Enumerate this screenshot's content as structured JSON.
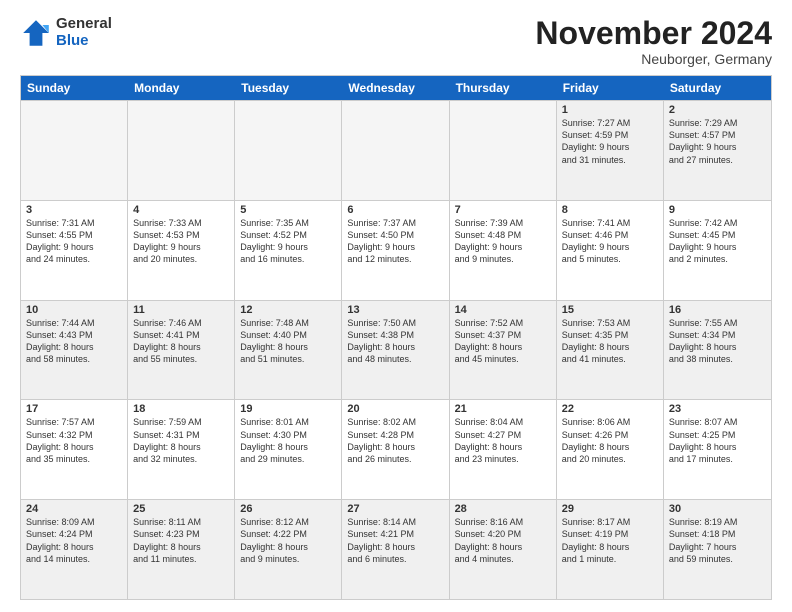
{
  "logo": {
    "general": "General",
    "blue": "Blue"
  },
  "title": "November 2024",
  "location": "Neuborger, Germany",
  "header_days": [
    "Sunday",
    "Monday",
    "Tuesday",
    "Wednesday",
    "Thursday",
    "Friday",
    "Saturday"
  ],
  "weeks": [
    [
      {
        "day": "",
        "info": "",
        "empty": true
      },
      {
        "day": "",
        "info": "",
        "empty": true
      },
      {
        "day": "",
        "info": "",
        "empty": true
      },
      {
        "day": "",
        "info": "",
        "empty": true
      },
      {
        "day": "",
        "info": "",
        "empty": true
      },
      {
        "day": "1",
        "info": "Sunrise: 7:27 AM\nSunset: 4:59 PM\nDaylight: 9 hours\nand 31 minutes."
      },
      {
        "day": "2",
        "info": "Sunrise: 7:29 AM\nSunset: 4:57 PM\nDaylight: 9 hours\nand 27 minutes."
      }
    ],
    [
      {
        "day": "3",
        "info": "Sunrise: 7:31 AM\nSunset: 4:55 PM\nDaylight: 9 hours\nand 24 minutes."
      },
      {
        "day": "4",
        "info": "Sunrise: 7:33 AM\nSunset: 4:53 PM\nDaylight: 9 hours\nand 20 minutes."
      },
      {
        "day": "5",
        "info": "Sunrise: 7:35 AM\nSunset: 4:52 PM\nDaylight: 9 hours\nand 16 minutes."
      },
      {
        "day": "6",
        "info": "Sunrise: 7:37 AM\nSunset: 4:50 PM\nDaylight: 9 hours\nand 12 minutes."
      },
      {
        "day": "7",
        "info": "Sunrise: 7:39 AM\nSunset: 4:48 PM\nDaylight: 9 hours\nand 9 minutes."
      },
      {
        "day": "8",
        "info": "Sunrise: 7:41 AM\nSunset: 4:46 PM\nDaylight: 9 hours\nand 5 minutes."
      },
      {
        "day": "9",
        "info": "Sunrise: 7:42 AM\nSunset: 4:45 PM\nDaylight: 9 hours\nand 2 minutes."
      }
    ],
    [
      {
        "day": "10",
        "info": "Sunrise: 7:44 AM\nSunset: 4:43 PM\nDaylight: 8 hours\nand 58 minutes."
      },
      {
        "day": "11",
        "info": "Sunrise: 7:46 AM\nSunset: 4:41 PM\nDaylight: 8 hours\nand 55 minutes."
      },
      {
        "day": "12",
        "info": "Sunrise: 7:48 AM\nSunset: 4:40 PM\nDaylight: 8 hours\nand 51 minutes."
      },
      {
        "day": "13",
        "info": "Sunrise: 7:50 AM\nSunset: 4:38 PM\nDaylight: 8 hours\nand 48 minutes."
      },
      {
        "day": "14",
        "info": "Sunrise: 7:52 AM\nSunset: 4:37 PM\nDaylight: 8 hours\nand 45 minutes."
      },
      {
        "day": "15",
        "info": "Sunrise: 7:53 AM\nSunset: 4:35 PM\nDaylight: 8 hours\nand 41 minutes."
      },
      {
        "day": "16",
        "info": "Sunrise: 7:55 AM\nSunset: 4:34 PM\nDaylight: 8 hours\nand 38 minutes."
      }
    ],
    [
      {
        "day": "17",
        "info": "Sunrise: 7:57 AM\nSunset: 4:32 PM\nDaylight: 8 hours\nand 35 minutes."
      },
      {
        "day": "18",
        "info": "Sunrise: 7:59 AM\nSunset: 4:31 PM\nDaylight: 8 hours\nand 32 minutes."
      },
      {
        "day": "19",
        "info": "Sunrise: 8:01 AM\nSunset: 4:30 PM\nDaylight: 8 hours\nand 29 minutes."
      },
      {
        "day": "20",
        "info": "Sunrise: 8:02 AM\nSunset: 4:28 PM\nDaylight: 8 hours\nand 26 minutes."
      },
      {
        "day": "21",
        "info": "Sunrise: 8:04 AM\nSunset: 4:27 PM\nDaylight: 8 hours\nand 23 minutes."
      },
      {
        "day": "22",
        "info": "Sunrise: 8:06 AM\nSunset: 4:26 PM\nDaylight: 8 hours\nand 20 minutes."
      },
      {
        "day": "23",
        "info": "Sunrise: 8:07 AM\nSunset: 4:25 PM\nDaylight: 8 hours\nand 17 minutes."
      }
    ],
    [
      {
        "day": "24",
        "info": "Sunrise: 8:09 AM\nSunset: 4:24 PM\nDaylight: 8 hours\nand 14 minutes."
      },
      {
        "day": "25",
        "info": "Sunrise: 8:11 AM\nSunset: 4:23 PM\nDaylight: 8 hours\nand 11 minutes."
      },
      {
        "day": "26",
        "info": "Sunrise: 8:12 AM\nSunset: 4:22 PM\nDaylight: 8 hours\nand 9 minutes."
      },
      {
        "day": "27",
        "info": "Sunrise: 8:14 AM\nSunset: 4:21 PM\nDaylight: 8 hours\nand 6 minutes."
      },
      {
        "day": "28",
        "info": "Sunrise: 8:16 AM\nSunset: 4:20 PM\nDaylight: 8 hours\nand 4 minutes."
      },
      {
        "day": "29",
        "info": "Sunrise: 8:17 AM\nSunset: 4:19 PM\nDaylight: 8 hours\nand 1 minute."
      },
      {
        "day": "30",
        "info": "Sunrise: 8:19 AM\nSunset: 4:18 PM\nDaylight: 7 hours\nand 59 minutes."
      }
    ]
  ]
}
